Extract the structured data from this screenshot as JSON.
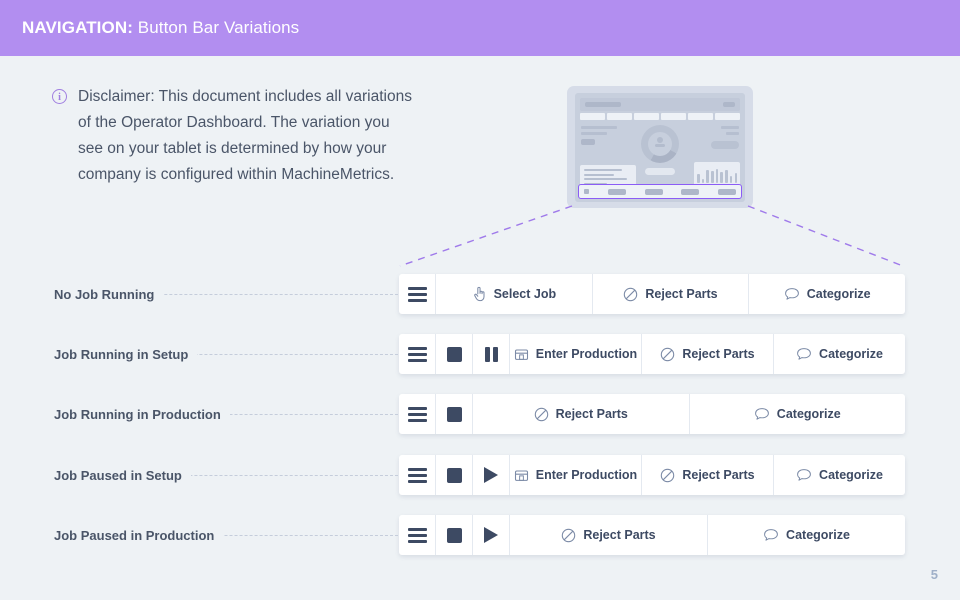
{
  "header": {
    "label": "NAVIGATION:",
    "title": "Button Bar Variations",
    "background": "#b28ef0",
    "text_color": "#ffffff"
  },
  "disclaimer": {
    "icon": "info-circle-icon",
    "text": "Disclaimer: This document includes all variations of the Operator Dashboard. The variation you see on your tablet is determined by how your company is configured within MachineMetrics."
  },
  "tablet": {
    "name": "operator-dashboard-tablet-mockup",
    "highlight_color": "#8b5cf6",
    "highlighted_region": "bottom-button-bar"
  },
  "connectors": {
    "color": "#9f7aea",
    "style": "dashed"
  },
  "rows": [
    {
      "label": "No Job Running",
      "buttons": [
        {
          "name": "menu-button",
          "icon": "hamburger-menu-icon",
          "label": "",
          "icon_only": true
        },
        {
          "name": "select-job-button",
          "icon": "pointing-hand-icon",
          "label": "Select Job",
          "icon_only": false
        },
        {
          "name": "reject-parts-button",
          "icon": "prohibition-icon",
          "label": "Reject Parts",
          "icon_only": false
        },
        {
          "name": "categorize-button",
          "icon": "speech-bubble-icon",
          "label": "Categorize",
          "icon_only": false
        }
      ]
    },
    {
      "label": "Job Running in Setup",
      "buttons": [
        {
          "name": "menu-button",
          "icon": "hamburger-menu-icon",
          "label": "",
          "icon_only": true
        },
        {
          "name": "stop-button",
          "icon": "stop-square-icon",
          "label": "",
          "icon_only": true
        },
        {
          "name": "pause-button",
          "icon": "pause-bars-icon",
          "label": "",
          "icon_only": true
        },
        {
          "name": "enter-production-button",
          "icon": "save-box-icon",
          "label": "Enter Production",
          "icon_only": false
        },
        {
          "name": "reject-parts-button",
          "icon": "prohibition-icon",
          "label": "Reject Parts",
          "icon_only": false
        },
        {
          "name": "categorize-button",
          "icon": "speech-bubble-icon",
          "label": "Categorize",
          "icon_only": false
        }
      ]
    },
    {
      "label": "Job Running in Production",
      "buttons": [
        {
          "name": "menu-button",
          "icon": "hamburger-menu-icon",
          "label": "",
          "icon_only": true
        },
        {
          "name": "stop-button",
          "icon": "stop-square-icon",
          "label": "",
          "icon_only": true
        },
        {
          "name": "reject-parts-button",
          "icon": "prohibition-icon",
          "label": "Reject Parts",
          "icon_only": false
        },
        {
          "name": "categorize-button",
          "icon": "speech-bubble-icon",
          "label": "Categorize",
          "icon_only": false
        }
      ]
    },
    {
      "label": "Job Paused in Setup",
      "buttons": [
        {
          "name": "menu-button",
          "icon": "hamburger-menu-icon",
          "label": "",
          "icon_only": true
        },
        {
          "name": "stop-button",
          "icon": "stop-square-icon",
          "label": "",
          "icon_only": true
        },
        {
          "name": "play-button",
          "icon": "play-triangle-icon",
          "label": "",
          "icon_only": true
        },
        {
          "name": "enter-production-button",
          "icon": "save-box-icon",
          "label": "Enter Production",
          "icon_only": false
        },
        {
          "name": "reject-parts-button",
          "icon": "prohibition-icon",
          "label": "Reject Parts",
          "icon_only": false
        },
        {
          "name": "categorize-button",
          "icon": "speech-bubble-icon",
          "label": "Categorize",
          "icon_only": false
        }
      ]
    },
    {
      "label": "Job Paused in Production",
      "buttons": [
        {
          "name": "menu-button",
          "icon": "hamburger-menu-icon",
          "label": "",
          "icon_only": true
        },
        {
          "name": "stop-button",
          "icon": "stop-square-icon",
          "label": "",
          "icon_only": true
        },
        {
          "name": "play-button",
          "icon": "play-triangle-icon",
          "label": "",
          "icon_only": true
        },
        {
          "name": "reject-parts-button",
          "icon": "prohibition-icon",
          "label": "Reject Parts",
          "icon_only": false
        },
        {
          "name": "categorize-button",
          "icon": "speech-bubble-icon",
          "label": "Categorize",
          "icon_only": false
        }
      ]
    }
  ],
  "page_number": "5"
}
